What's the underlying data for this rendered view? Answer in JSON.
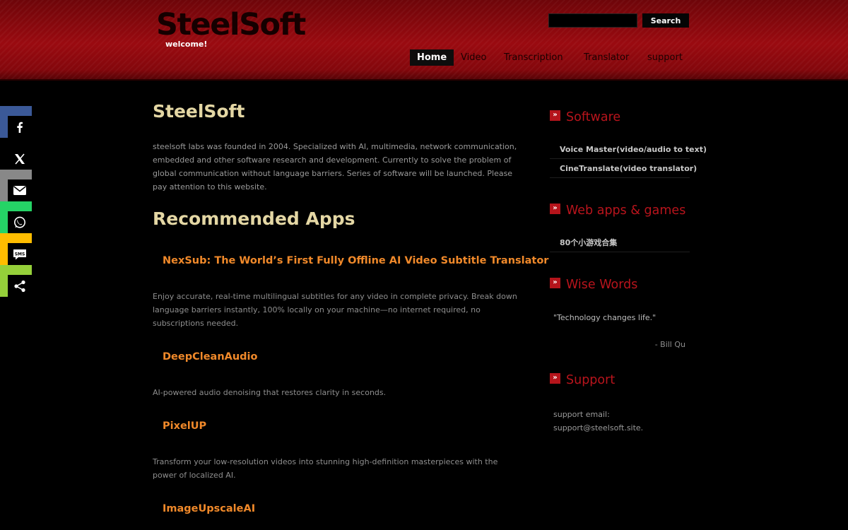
{
  "header": {
    "logo": "SteelSoft",
    "tagline": "welcome!",
    "search": {
      "value": "",
      "placeholder": "",
      "button_label": "Search"
    },
    "nav": [
      {
        "label": "Home",
        "active": true
      },
      {
        "label": "Video"
      },
      {
        "label": "Transcription"
      },
      {
        "label": "Translator"
      },
      {
        "label": "support"
      }
    ]
  },
  "social": [
    {
      "name": "facebook-icon",
      "color": "#3b5998"
    },
    {
      "name": "x-icon",
      "color": "#000000"
    },
    {
      "name": "email-icon",
      "color": "#888888"
    },
    {
      "name": "whatsapp-icon",
      "color": "#25d366"
    },
    {
      "name": "sms-icon",
      "color": "#ffbd00",
      "text": "SMS"
    },
    {
      "name": "share-icon",
      "color": "#95d03a"
    }
  ],
  "main": {
    "title": "SteelSoft",
    "about": "steelsoft labs was founded in 2004. Specialized with AI, multimedia, network communication, embedded and other software research and development. Currently to solve the problem of global communication without language barriers. Series of software will be launched. Please pay attention to this website.",
    "recommended_title": "Recommended Apps",
    "apps": [
      {
        "title": "NexSub: The World’s First Fully Offline AI Video Subtitle Translator",
        "desc": "Enjoy accurate, real-time multilingual subtitles for any video in complete privacy. Break down language barriers instantly, 100% locally on your machine—no internet required, no subscriptions needed."
      },
      {
        "title": "DeepCleanAudio",
        "desc": "AI-powered audio denoising that restores clarity in seconds."
      },
      {
        "title": "PixelUP",
        "desc": "Transform your low-resolution videos into stunning high-definition masterpieces with the power of localized AI."
      },
      {
        "title": "ImageUpscaleAI",
        "desc": ""
      }
    ]
  },
  "sidebar": {
    "software": {
      "title": "Software",
      "items": [
        "Voice Master(video/audio to text)",
        "CineTranslate(video translator)"
      ]
    },
    "webapps": {
      "title": "Web apps & games",
      "items": [
        "80个小游戏合集"
      ]
    },
    "wise": {
      "title": "Wise Words",
      "quote": "\"Technology changes life.\"",
      "author": "- Bill Qu"
    },
    "support": {
      "title": "Support",
      "line1": "support email:",
      "line2": "support@steelsoft.site."
    }
  },
  "colors": {
    "header_red": "#9a0a10",
    "accent_orange": "#f0892a",
    "heading_cream": "#e4d7a4",
    "sidebar_red": "#b8141c"
  }
}
